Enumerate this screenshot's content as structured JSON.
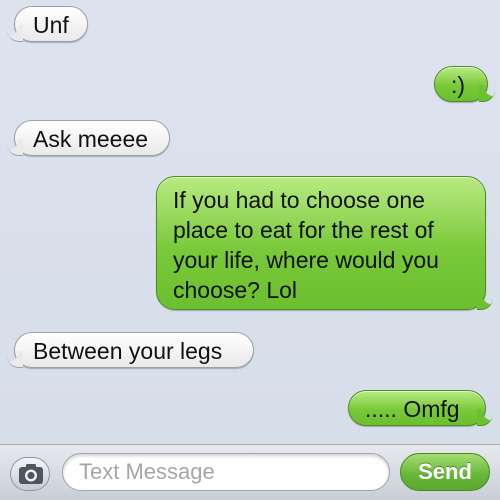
{
  "messages": [
    {
      "direction": "received",
      "text": "Unf"
    },
    {
      "direction": "sent",
      "text": ":)"
    },
    {
      "direction": "received",
      "text": "Ask meeee"
    },
    {
      "direction": "sent",
      "text": "If you had to choose one place to eat for the rest of your life, where would you choose? Lol"
    },
    {
      "direction": "received",
      "text": "Between your legs"
    },
    {
      "direction": "sent",
      "text": "..... Omfg"
    }
  ],
  "composer": {
    "camera_icon": "camera-icon",
    "placeholder": "Text Message",
    "send_label": "Send"
  },
  "colors": {
    "background": "#dbe2ed",
    "sent_bubble": "#79c93a",
    "received_bubble": "#ffffff",
    "send_button": "#6ab83a"
  }
}
